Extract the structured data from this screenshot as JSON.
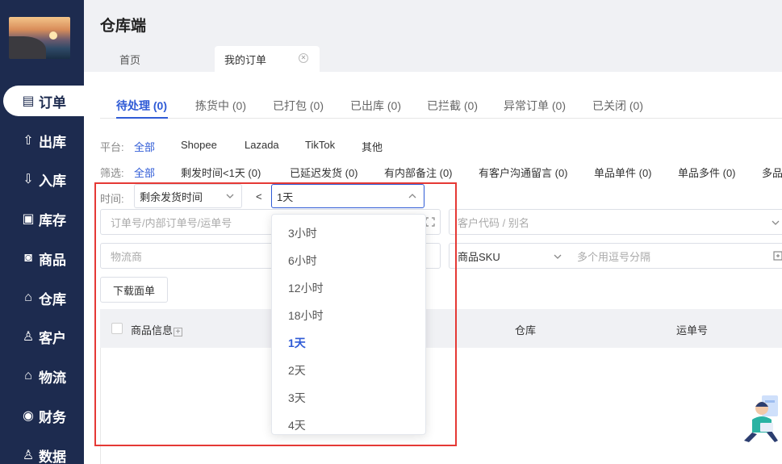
{
  "app": {
    "title": "仓库端"
  },
  "sidebar": {
    "items": [
      {
        "label": "订单",
        "icon": "clipboard-icon",
        "glyph": "▤",
        "active": true
      },
      {
        "label": "出库",
        "icon": "outbound-icon",
        "glyph": "⇧"
      },
      {
        "label": "入库",
        "icon": "inbound-icon",
        "glyph": "⇩"
      },
      {
        "label": "库存",
        "icon": "inventory-icon",
        "glyph": "▣"
      },
      {
        "label": "商品",
        "icon": "bag-icon",
        "glyph": "◙"
      },
      {
        "label": "仓库",
        "icon": "warehouse-icon",
        "glyph": "⌂"
      },
      {
        "label": "客户",
        "icon": "user-icon",
        "glyph": "♙"
      },
      {
        "label": "物流",
        "icon": "logistics-icon",
        "glyph": "⌂"
      },
      {
        "label": "财务",
        "icon": "finance-icon",
        "glyph": "◉"
      },
      {
        "label": "数据",
        "icon": "data-icon",
        "glyph": "♙"
      }
    ]
  },
  "tabs": {
    "home": "首页",
    "orders": "我的订单"
  },
  "status_tabs": [
    "待处理 (0)",
    "拣货中 (0)",
    "已打包 (0)",
    "已出库 (0)",
    "已拦截 (0)",
    "异常订单 (0)",
    "已关闭 (0)"
  ],
  "platform": {
    "label": "平台:",
    "options": [
      "全部",
      "Shopee",
      "Lazada",
      "TikTok",
      "其他"
    ]
  },
  "screen": {
    "label": "筛选:",
    "options": [
      "全部",
      "剩发时间<1天 (0)",
      "已延迟发货 (0)",
      "有内部备注 (0)",
      "有客户沟通留言 (0)",
      "单品单件 (0)",
      "单品多件 (0)",
      "多品"
    ]
  },
  "time": {
    "label": "时间:",
    "type_value": "剩余发货时间",
    "operator": "<",
    "value": "1天"
  },
  "inputs": {
    "order_placeholder": "订单号/内部订单号/运单号",
    "customer_placeholder": "客户代码 / 别名",
    "carrier_placeholder": "物流商",
    "sku_select": "商品SKU",
    "sku_placeholder": "多个用逗号分隔"
  },
  "buttons": {
    "download": "下载面单"
  },
  "table": {
    "headers": [
      "商品信息",
      "仓库",
      "运单号"
    ]
  },
  "dropdown": {
    "options": [
      "3小时",
      "6小时",
      "12小时",
      "18小时",
      "1天",
      "2天",
      "3天",
      "4天"
    ],
    "selected": "1天"
  },
  "colors": {
    "sidebar": "#1d2b4f",
    "accent": "#2f5bd6",
    "highlight": "#e53935"
  }
}
